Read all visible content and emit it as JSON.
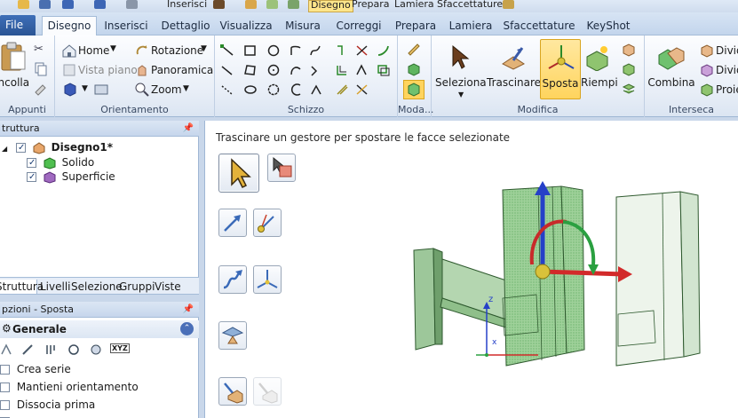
{
  "qat": {
    "insert_label": "Inserisci",
    "modes": [
      "Disegno",
      "Prepara",
      "Lamiera",
      "Sfaccettature"
    ],
    "active_mode": "Disegno"
  },
  "tabs": {
    "file": "File",
    "items": [
      "Disegno",
      "Inserisci",
      "Dettaglio",
      "Visualizza",
      "Misura",
      "Correggi",
      "Prepara",
      "Lamiera",
      "Sfaccettature",
      "KeyShot"
    ],
    "active": "Disegno"
  },
  "ribbon": {
    "clipboard": {
      "paste": "Incolla",
      "label": "Appunti"
    },
    "orient": {
      "home": "Home",
      "plan_view": "Vista piano",
      "rotate": "Rotazione",
      "pan": "Panoramica",
      "zoom": "Zoom",
      "label": "Orientamento"
    },
    "sketch": {
      "label": "Schizzo"
    },
    "mode": {
      "label": "Moda..."
    },
    "edit": {
      "select": "Seleziona",
      "drag": "Trascinare",
      "move": "Sposta",
      "fill": "Riempi",
      "label": "Modifica"
    },
    "intersect": {
      "combine": "Combina",
      "divide1": "Divid",
      "divide2": "Divid",
      "project": "Proie",
      "label": "Interseca"
    }
  },
  "structure": {
    "title": "truttura",
    "root": "Disegno1*",
    "items": [
      "Solido",
      "Superficie"
    ]
  },
  "panel_tabs": [
    "Struttura",
    "Livelli",
    "Selezione",
    "Gruppi",
    "Viste"
  ],
  "options": {
    "title": "pzioni - Sposta",
    "section": "Generale",
    "xyz": "XYZ",
    "items": [
      "Crea serie",
      "Mantieni orientamento",
      "Dissocia prima"
    ]
  },
  "viewport": {
    "hint": "Trascinare un gestore per spostare le facce selezionate"
  },
  "colors": {
    "accent": "#ffd45e",
    "solid_green": "#9fd19a",
    "handle_blue": "#2540c8",
    "handle_red": "#d22a2a",
    "handle_green": "#2aa040"
  }
}
